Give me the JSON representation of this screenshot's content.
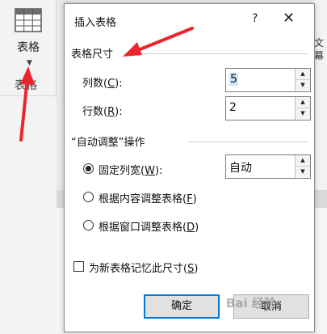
{
  "ribbon": {
    "table_button_label": "表格",
    "group_label": "表格",
    "right_partial_1": "文",
    "right_partial_2": "幕"
  },
  "dialog": {
    "title": "插入表格",
    "help_label": "?",
    "close_label": "✕",
    "size_section": "表格尺寸",
    "columns": {
      "label_pre": "列数(",
      "hotkey": "C",
      "label_post": "):",
      "value": "5"
    },
    "rows": {
      "label_pre": "行数(",
      "hotkey": "R",
      "label_post": "):",
      "value": "2"
    },
    "autofit_section": "“自动调整”操作",
    "fixed_width": {
      "label_pre": "固定列宽(",
      "hotkey": "W",
      "label_post": "):",
      "value": "自动",
      "selected": true
    },
    "fit_content": {
      "label_pre": "根据内容调整表格(",
      "hotkey": "F",
      "label_post": ")",
      "selected": false
    },
    "fit_window": {
      "label_pre": "根据窗口调整表格(",
      "hotkey": "D",
      "label_post": ")",
      "selected": false
    },
    "remember": {
      "label_pre": "为新表格记忆此尺寸(",
      "hotkey": "S",
      "label_post": ")",
      "checked": false
    },
    "ok_label": "确定",
    "cancel_label": "取消"
  },
  "watermark": "Bai 经验",
  "colors": {
    "arrow": "#e8262b",
    "focus": "#0078d7"
  }
}
